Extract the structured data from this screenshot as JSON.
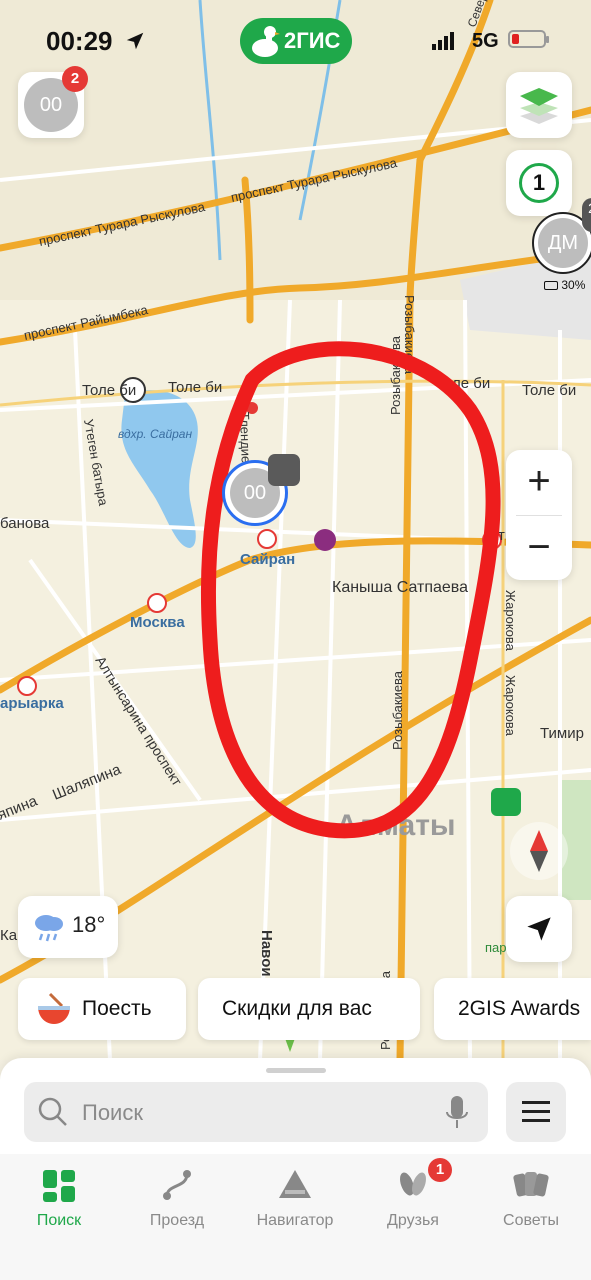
{
  "status_bar": {
    "time": "00:29",
    "network": "5G"
  },
  "brand": {
    "name": "2ГИС"
  },
  "profile": {
    "initials": "00",
    "badge": "2"
  },
  "layers": {},
  "counter_button": {
    "value": "1"
  },
  "friend": {
    "initials": "ДМ",
    "battery": "30%",
    "mini_badge": "2"
  },
  "map": {
    "labels": {
      "tulebaev_top": "Северная",
      "rysk_1": "проспект Турара Рыскулова",
      "rysk_2": "проспект Турара Рыскулова",
      "raiymbek": "проспект Райымбека",
      "tole_bi_1": "Толе би",
      "tole_bi_2": "Толе би",
      "tole_bi_3": "Толе би",
      "tole_bi_4": "Толе би",
      "reservoir": "вдхр. Сайран",
      "utegen": "Утеген батыра",
      "tlendiev": "Тлендиева",
      "rozybakieva_1": "Розыбакиева",
      "rozybakieva_2": "Розыбакиева",
      "rozybakieva_3": "Розыбакиева",
      "abaya_left": "банова",
      "sairan": "Сайран",
      "moskva": "Москва",
      "satpaev": "Каныша Сатпаева",
      "zharokova_1": "Жарокова",
      "zharokova_2": "Жарокова",
      "timiryazev": "Тимир",
      "altynsarin": "Алтынсарина проспект",
      "shalyapin": "Шаляпина",
      "yapina": "япина",
      "saryarka": "арыарка",
      "almaty": "Алматы",
      "navoi": "Навои",
      "park": "пар",
      "almatinka": "атинка",
      "ka": "Ка"
    }
  },
  "me": {
    "initials": "00"
  },
  "weather": {
    "temp": "18°"
  },
  "zoom": {
    "plus": "+",
    "minus": "−"
  },
  "pills": [
    {
      "label": "Поесть"
    },
    {
      "label": "Скидки для вас"
    },
    {
      "label": "2GIS Awards"
    }
  ],
  "search": {
    "placeholder": "Поиск"
  },
  "tabs": [
    {
      "label": "Поиск",
      "active": true
    },
    {
      "label": "Проезд"
    },
    {
      "label": "Навигатор"
    },
    {
      "label": "Друзья",
      "badge": "1"
    },
    {
      "label": "Советы"
    }
  ],
  "colors": {
    "brand_green": "#1fa84a",
    "badge_red": "#e53935",
    "annotation_red": "#ee1d1d",
    "road_orange": "#f0a92a"
  }
}
